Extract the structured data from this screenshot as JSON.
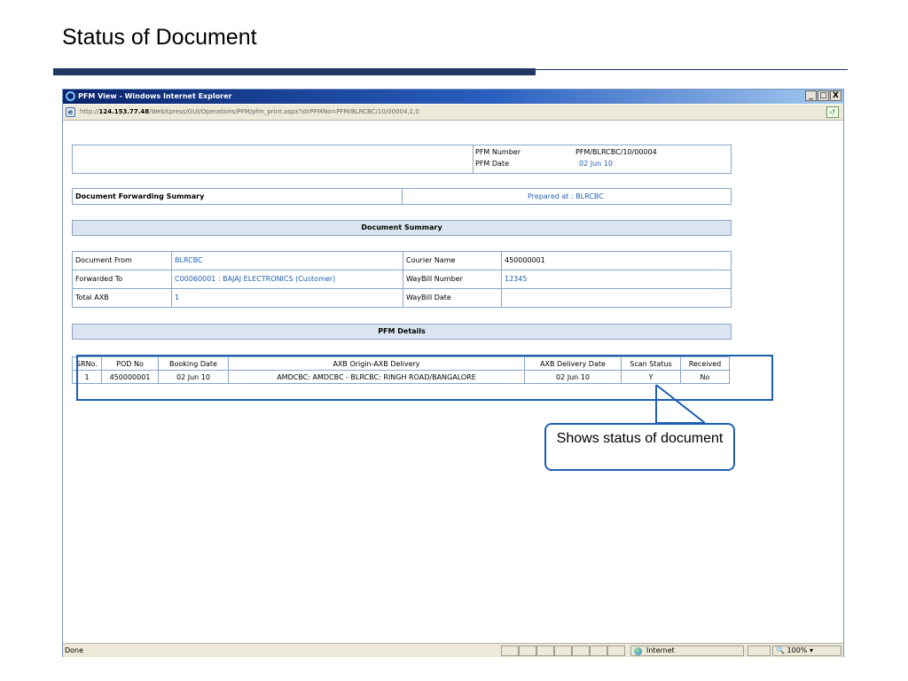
{
  "slide": {
    "title": "Status of Document"
  },
  "window": {
    "title": "PFM View - Windows Internet Explorer",
    "buttons": {
      "minimize": "_",
      "maximize": "8",
      "close": "X"
    },
    "address": {
      "prefix": "http://",
      "host": "124.153.77.48",
      "path": "/WebXpress/GUI/Operations/PFM/pfm_print.aspx?strPFMNo=PFM/BLRCBC/10/00004,1,0"
    }
  },
  "pfm_header": {
    "number_label": "PFM Number",
    "number_value": "PFM/BLRCBC/10/00004",
    "date_label": "PFM Date",
    "date_value": "02 Jun 10"
  },
  "forwarding": {
    "title": "Document Forwarding Summary",
    "prepared": "Prepared at : BLRCBC"
  },
  "summary": {
    "title": "Document Summary",
    "rows": [
      {
        "label": "Document From",
        "value": "BLRCBC",
        "label2": "Courier Name",
        "value2": "450000001"
      },
      {
        "label": "Forwarded To",
        "value": "C00060001 : BAJAJ ELECTRONICS (Customer)",
        "label2": "WayBill Number",
        "value2": "12345"
      },
      {
        "label": "Total AXB",
        "value": "1",
        "label2": "WayBill Date",
        "value2": ""
      }
    ]
  },
  "pfm_details": {
    "title": "PFM Details",
    "columns": [
      "SRNo.",
      "POD No",
      "Booking Date",
      "AXB Origin-AXB Delivery",
      "AXB Delivery Date",
      "Scan Status",
      "Received"
    ],
    "rows": [
      [
        "1",
        "450000001",
        "02 Jun 10",
        "AMDCBC: AMDCBC - BLRCBC: RINGH ROAD/BANGALORE",
        "02 Jun 10",
        "Y",
        "No"
      ]
    ]
  },
  "callout": {
    "text": "Shows status of document"
  },
  "statusbar": {
    "left": "Done",
    "zone": "Internet",
    "zoom": "100%"
  },
  "colors": {
    "title_bar": "#0a246a",
    "accent": "#1f5fb0",
    "header_fill": "#dbe5f1"
  }
}
